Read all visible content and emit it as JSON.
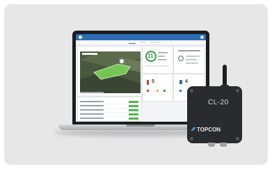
{
  "image": {
    "description_tags": [
      "laptop",
      "dashboard",
      "telematics-device",
      "antenna"
    ],
    "colors": {
      "panel_bg": "#e7e7e8",
      "app_header": "#2d6db5",
      "accent_green": "#2e9e3e",
      "device_body": "#2a2b2e"
    }
  },
  "device": {
    "model_label": "CL-20",
    "brand_label": "TOPCON"
  },
  "dashboard": {
    "big_number": "11",
    "secondary_number": "5",
    "tertiary_number": "4"
  }
}
